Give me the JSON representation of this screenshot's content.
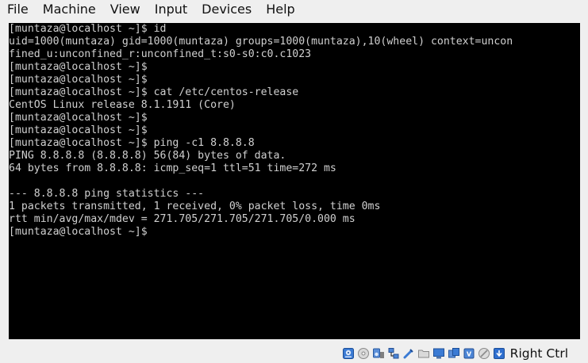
{
  "menu": {
    "items": [
      "File",
      "Machine",
      "View",
      "Input",
      "Devices",
      "Help"
    ]
  },
  "console": {
    "lines": [
      "[muntaza@localhost ~]$ id",
      "uid=1000(muntaza) gid=1000(muntaza) groups=1000(muntaza),10(wheel) context=uncon",
      "fined_u:unconfined_r:unconfined_t:s0-s0:c0.c1023",
      "[muntaza@localhost ~]$",
      "[muntaza@localhost ~]$",
      "[muntaza@localhost ~]$ cat /etc/centos-release",
      "CentOS Linux release 8.1.1911 (Core)",
      "[muntaza@localhost ~]$",
      "[muntaza@localhost ~]$",
      "[muntaza@localhost ~]$ ping -c1 8.8.8.8",
      "PING 8.8.8.8 (8.8.8.8) 56(84) bytes of data.",
      "64 bytes from 8.8.8.8: icmp_seq=1 ttl=51 time=272 ms",
      "",
      "--- 8.8.8.8 ping statistics ---",
      "1 packets transmitted, 1 received, 0% packet loss, time 0ms",
      "rtt min/avg/max/mdev = 271.705/271.705/271.705/0.000 ms",
      "[muntaza@localhost ~]$"
    ]
  },
  "statusbar": {
    "host_key": "Right Ctrl",
    "icons": [
      "hard-disk-icon",
      "optical-drive-icon",
      "audio-icon",
      "network-icon",
      "usb-icon",
      "shared-folders-icon",
      "display-icon",
      "video-capture-icon",
      "virtualization-icon",
      "mouse-integration-icon",
      "keyboard-capture-icon"
    ]
  },
  "colors": {
    "console_bg": "#000000",
    "console_fg": "#d0d0d0",
    "chrome_bg": "#efefef"
  }
}
